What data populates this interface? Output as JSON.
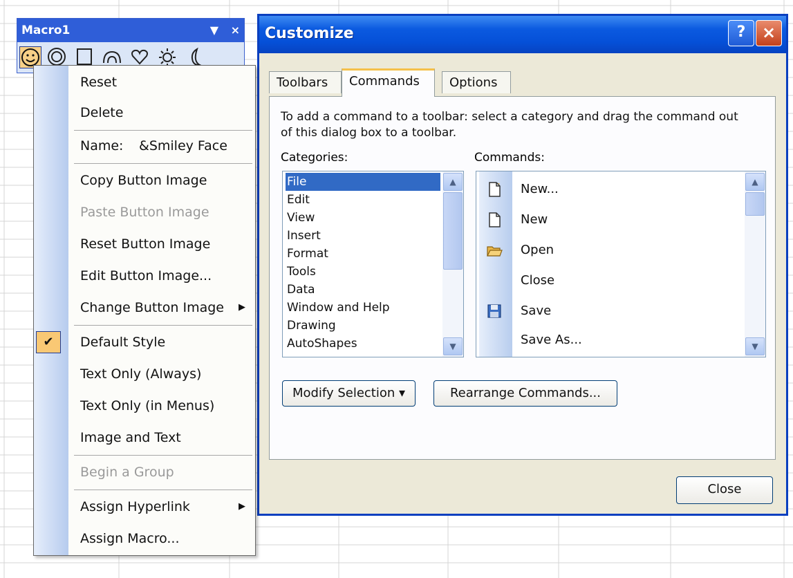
{
  "macro_toolbar": {
    "title": "Macro1",
    "controls": {
      "dropdown": "▼",
      "close": "×"
    },
    "icons": [
      "smiley-face-icon",
      "circle-icon",
      "square-icon",
      "arch-icon",
      "heart-icon",
      "sun-icon",
      "moon-icon"
    ]
  },
  "context_menu": {
    "reset": "Reset",
    "delete": "Delete",
    "name_label": "Name:",
    "name_value": "&Smiley Face",
    "copy_image": "Copy Button Image",
    "paste_image": "Paste Button Image",
    "reset_image": "Reset Button Image",
    "edit_image": "Edit Button Image...",
    "change_image": "Change Button Image",
    "default_style": "Default Style",
    "text_only_always": "Text Only (Always)",
    "text_only_menus": "Text Only (in Menus)",
    "image_and_text": "Image and Text",
    "begin_group": "Begin a Group",
    "assign_hyperlink": "Assign Hyperlink",
    "assign_macro": "Assign Macro..."
  },
  "dialog": {
    "title": "Customize",
    "help": "?",
    "close_x": "×",
    "tabs": [
      "Toolbars",
      "Commands",
      "Options"
    ],
    "active_tab": "Commands",
    "instructions": "To add a command to a toolbar: select a category and drag the command out of this dialog box to a toolbar.",
    "categories_label": "Categories:",
    "commands_label": "Commands:",
    "categories": [
      "File",
      "Edit",
      "View",
      "Insert",
      "Format",
      "Tools",
      "Data",
      "Window and Help",
      "Drawing",
      "AutoShapes"
    ],
    "selected_category": "File",
    "commands": [
      {
        "label": "New...",
        "icon": "new-document-icon"
      },
      {
        "label": "New",
        "icon": "new-document-icon"
      },
      {
        "label": "Open",
        "icon": "open-folder-icon"
      },
      {
        "label": "Close",
        "icon": ""
      },
      {
        "label": "Save",
        "icon": "save-disk-icon"
      },
      {
        "label": "Save As...",
        "icon": ""
      }
    ],
    "modify_selection": "Modify Selection ▾",
    "rearrange_commands": "Rearrange Commands...",
    "close_button": "Close"
  },
  "colors": {
    "titlebar_blue": "#0550d8",
    "selection_blue": "#316ac5",
    "checked_highlight": "#f9c874",
    "active_tab_accent": "#f5c04a",
    "close_red": "#c3411c"
  }
}
